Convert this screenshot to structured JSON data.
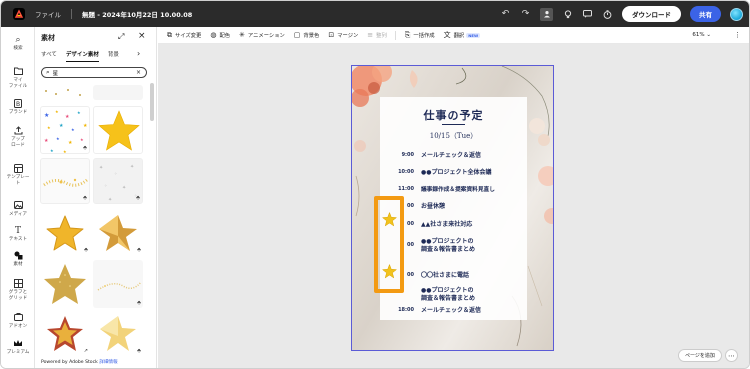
{
  "topbar": {
    "app_logo": "adobe-express-logo",
    "file_menu": "ファイル",
    "document_title": "無題 - 2024年10月22日 10.00.08",
    "undo_icon": "undo-icon",
    "redo_icon": "redo-icon",
    "download_label": "ダウンロード",
    "share_label": "共有"
  },
  "rail": {
    "items": [
      {
        "label": "検索",
        "icon": "search-icon"
      },
      {
        "label": "マイ\nファイル",
        "icon": "folder-icon"
      },
      {
        "label": "ブランド",
        "icon": "brand-icon"
      },
      {
        "label": "アップ\nロード",
        "icon": "upload-icon"
      },
      {
        "label": "テンプレー\nト",
        "icon": "template-icon"
      },
      {
        "label": "メディア",
        "icon": "media-icon"
      },
      {
        "label": "テキスト",
        "icon": "text-icon"
      },
      {
        "label": "素材",
        "icon": "elements-icon"
      },
      {
        "label": "グラフと\nグリッド",
        "icon": "chart-icon"
      },
      {
        "label": "アドオン",
        "icon": "addon-icon"
      },
      {
        "label": "プレミアム",
        "icon": "crown-icon"
      }
    ]
  },
  "panel": {
    "title": "素材",
    "tabs": [
      "すべて",
      "デザイン素材",
      "背景"
    ],
    "active_tab": "デザイン素材",
    "search_value": "星",
    "powered_by": "Powered by Adobe Stock",
    "details_link": "詳細情報"
  },
  "toolbar": {
    "tools": [
      {
        "label": "サイズ変更",
        "icon": "resize-icon",
        "enabled": true
      },
      {
        "label": "配色",
        "icon": "palette-icon",
        "enabled": true
      },
      {
        "label": "アニメーション",
        "icon": "animation-icon",
        "enabled": true
      },
      {
        "label": "背景色",
        "icon": "background-icon",
        "enabled": true
      },
      {
        "label": "マージン",
        "icon": "margin-icon",
        "enabled": true
      },
      {
        "label": "整列",
        "icon": "align-icon",
        "enabled": false
      },
      {
        "label": "一括作成",
        "icon": "bulk-create-icon",
        "enabled": true
      },
      {
        "label": "翻訳",
        "icon": "translate-icon",
        "enabled": true
      }
    ],
    "new_badge": "NEW",
    "zoom": "61%"
  },
  "document": {
    "title": "仕事の予定",
    "date": "10/15（Tue）",
    "schedule": [
      {
        "time": "9:00",
        "text": "メールチェック＆返信"
      },
      {
        "time": "10:00",
        "text": "●●プロジェクト全体会議"
      },
      {
        "time": "11:00",
        "text": "議事録作成＆提案資料見直し"
      },
      {
        "time": "00",
        "text": "お昼休憩"
      },
      {
        "time": "00",
        "text": "▲▲社さま来社対応"
      },
      {
        "time": "00",
        "text": "●●プロジェクトの\n調査＆報告書まとめ"
      },
      {
        "time": "00",
        "text": "〇〇社さまに電話"
      },
      {
        "time": "",
        "text": "●●プロジェクトの\n調査＆報告書まとめ"
      },
      {
        "time": "18:00",
        "text": "メールチェック＆返信"
      }
    ]
  },
  "canvas": {
    "add_page_label": "ページを追加"
  },
  "colors": {
    "topbar_bg": "#2b2b2b",
    "share_button": "#3b63e6",
    "highlight_orange": "#f39a12",
    "doc_text_navy": "#1e2a56",
    "selection_border": "#5b5bd6"
  }
}
